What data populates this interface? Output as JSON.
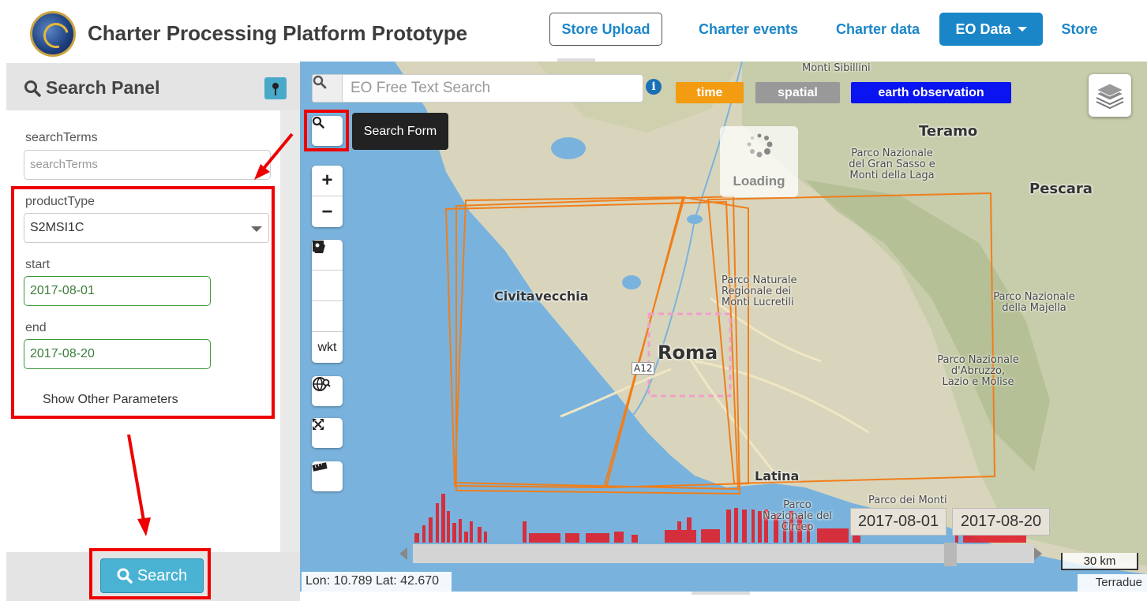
{
  "header": {
    "title": "Charter Processing Platform Prototype",
    "nav": {
      "store_upload": "Store Upload",
      "charter_events": "Charter events",
      "charter_data": "Charter data",
      "eo_data": "EO Data",
      "store": "Store"
    }
  },
  "sidebar": {
    "panel_title": "Search Panel",
    "fields": {
      "search_terms_label": "searchTerms",
      "search_terms_placeholder": "searchTerms",
      "product_type_label": "productType",
      "product_type_value": "S2MSI1C",
      "start_label": "start",
      "start_value": "2017-08-01",
      "end_label": "end",
      "end_value": "2017-08-20"
    },
    "show_other": "Show Other Parameters",
    "search_button": "Search"
  },
  "map": {
    "free_text_placeholder": "EO Free Text Search",
    "info_symbol": "i",
    "tags": {
      "time": "time",
      "spatial": "spatial",
      "eo": "earth observation"
    },
    "tooltip": "Search Form",
    "loading": "Loading",
    "tools": {
      "zoom_in": "+",
      "zoom_out": "−",
      "wkt": "wkt"
    },
    "places": {
      "monti_sibillini": "Monti Sibillini",
      "teramo": "Teramo",
      "gran_sasso": "Parco Nazionale del Gran Sasso e Monti della Laga",
      "pescara": "Pescara",
      "civitavecchia": "Civitavecchia",
      "lucretili": "Parco Naturale Regionale dei Monti Lucretili",
      "majella": "Parco Nazionale della Majella",
      "roma": "Roma",
      "a12": "A12",
      "abruzzo": "Parco Nazionale d'Abruzzo, Lazio e Molise",
      "latina": "Latina",
      "circeo": "Parco Nazionale del Circeo",
      "parco_monti": "Parco dei Monti"
    },
    "timeline": {
      "start_date": "2017-08-01",
      "end_date": "2017-08-20"
    },
    "scale_label": "30 km",
    "coordinates": "Lon: 10.789 Lat: 42.670",
    "attribution": "Terradue"
  },
  "colors": {
    "accent": "#1a86c8",
    "tag_time": "#f39c12",
    "tag_spatial": "#999999",
    "tag_eo": "#0a14f0",
    "footprint": "#f07e1b",
    "highlight_box": "#e00000",
    "sea": "#79b3dd"
  },
  "icons": [
    "logo-icon",
    "search-icon",
    "pin-icon",
    "info-icon",
    "layers-icon",
    "polygon-icon",
    "square-icon",
    "marker-icon",
    "globe-search-icon",
    "fullscreen-icon",
    "ruler-icon",
    "loading-spinner-icon"
  ]
}
